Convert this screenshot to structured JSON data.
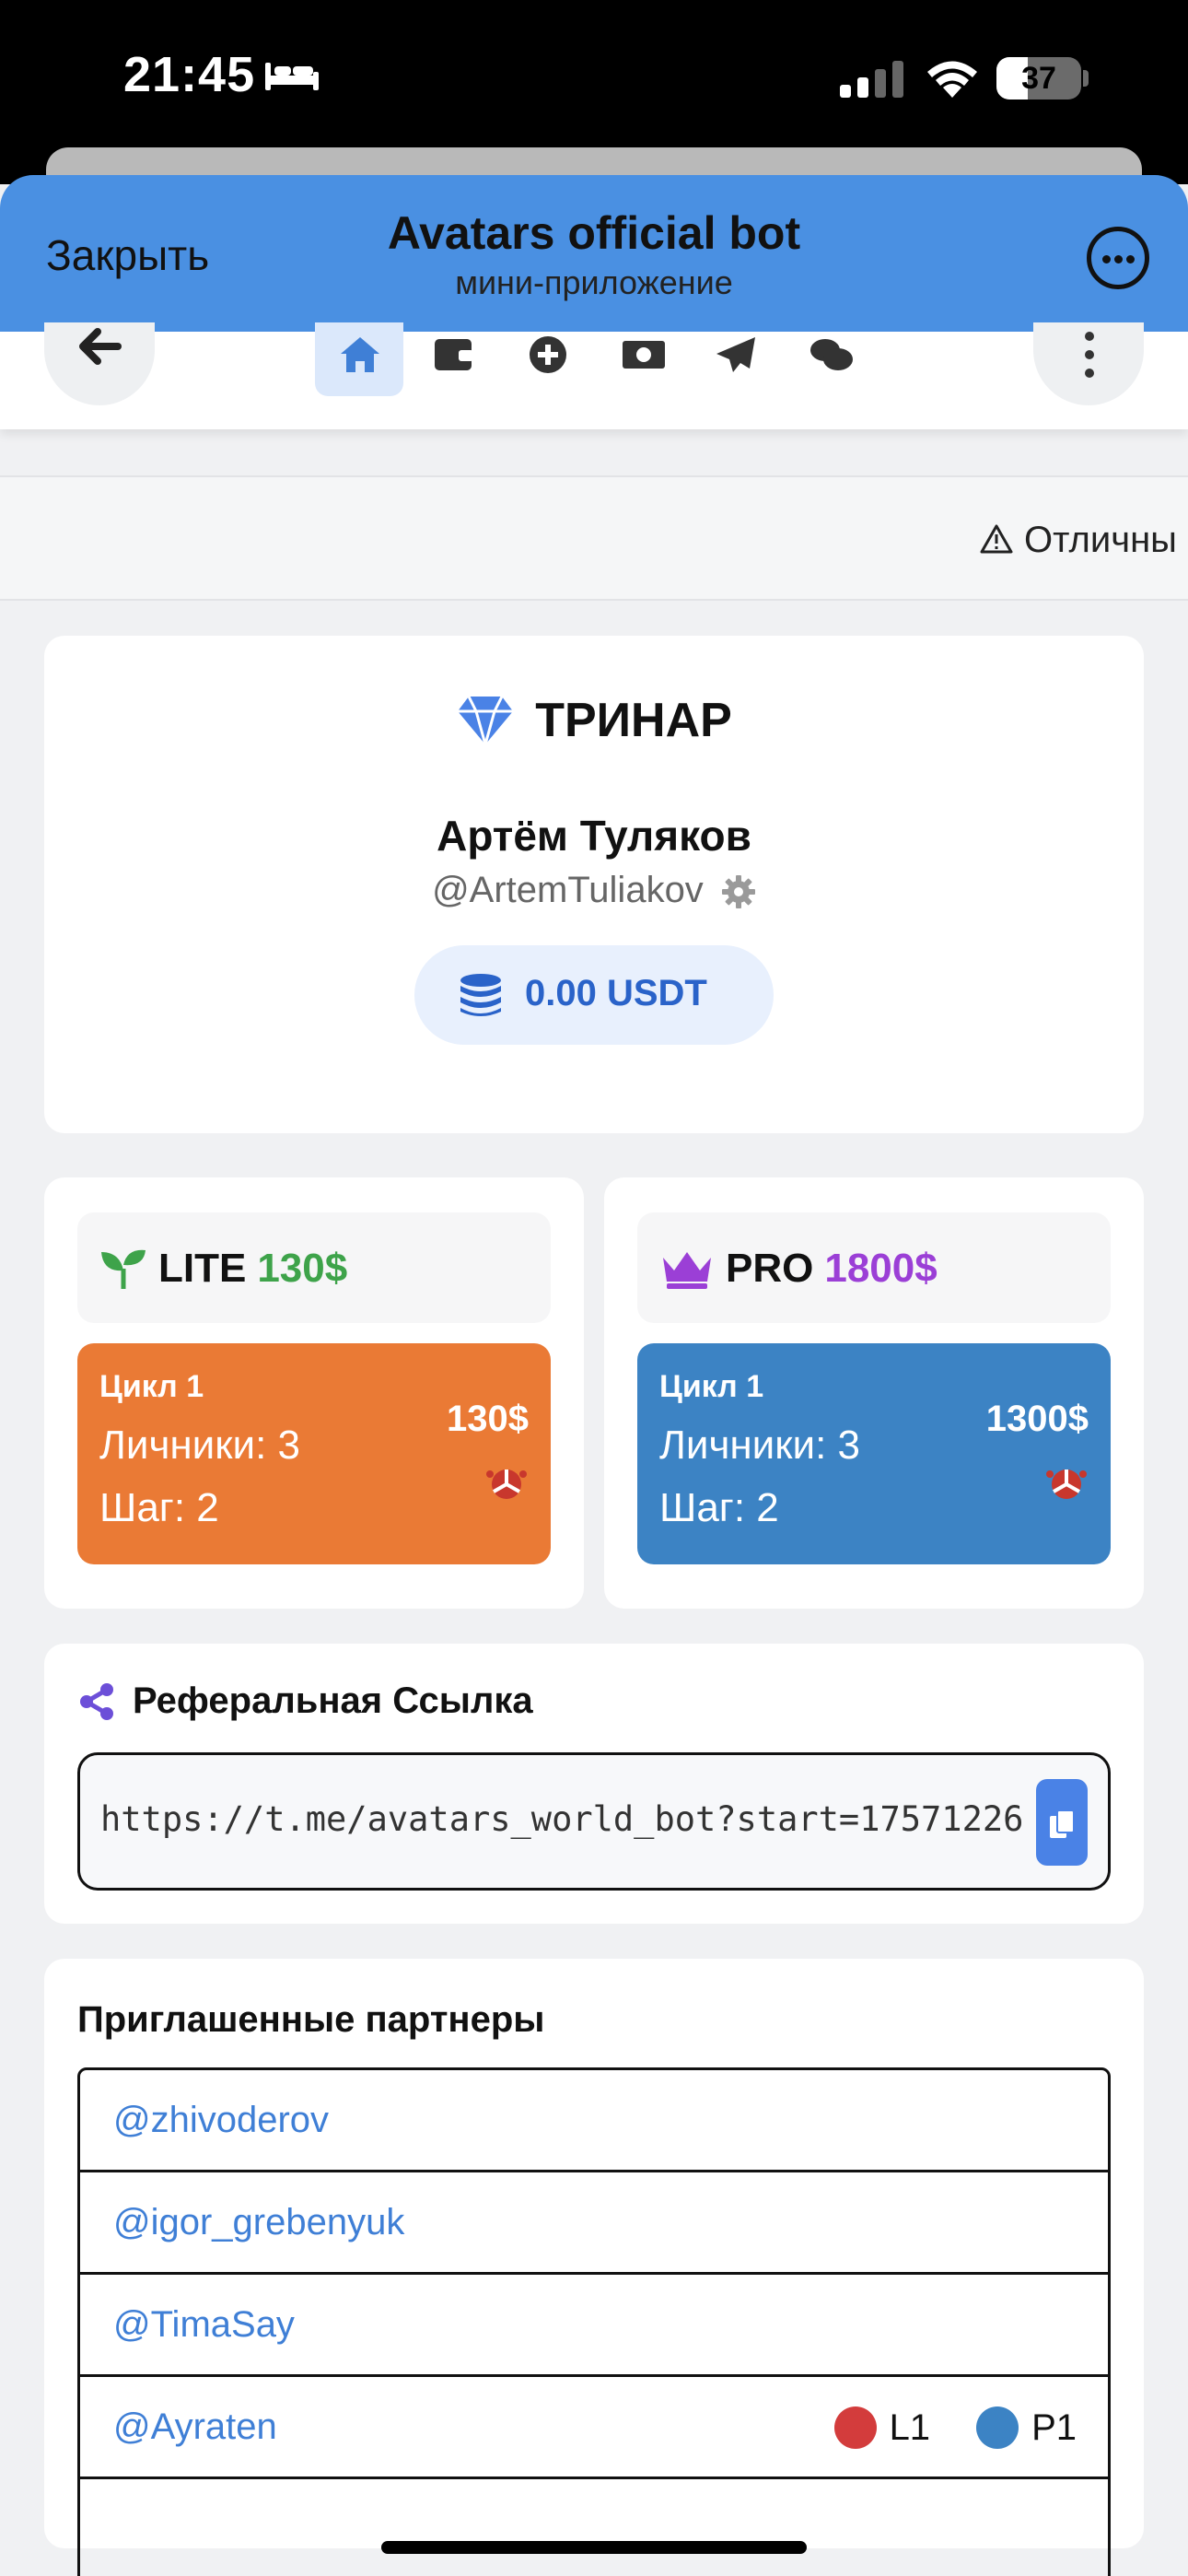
{
  "status_bar": {
    "time": "21:45",
    "battery": "37",
    "battery_fraction": 0.37
  },
  "telegram_header": {
    "close_label": "Закрыть",
    "title": "Avatars official bot",
    "subtitle": "мини-приложение"
  },
  "nav": {
    "icons": [
      "home-icon",
      "wallet-icon",
      "plus-circle-icon",
      "money-icon",
      "send-icon",
      "chat-icon"
    ],
    "active_index": 0
  },
  "notice": {
    "text": "Отличны"
  },
  "profile": {
    "brand": "ТРИНАР",
    "name": "Артём Туляков",
    "handle": "@ArtemTuliakov",
    "balance": "0.00 USDT"
  },
  "plans": {
    "lite": {
      "name": "LITE",
      "price": "130$",
      "cycle": "Цикл 1",
      "personal": "Личники: 3",
      "step": "Шаг: 2",
      "amount": "130$"
    },
    "pro": {
      "name": "PRO",
      "price": "1800$",
      "cycle": "Цикл 1",
      "personal": "Личники: 3",
      "step": "Шаг: 2",
      "amount": "1300$"
    }
  },
  "referral": {
    "title": "Реферальная Ссылка",
    "link": "https://t.me/avatars_world_bot?start=17571226"
  },
  "partners": {
    "title": "Приглашенные партнеры",
    "items": [
      {
        "handle": "@zhivoderov"
      },
      {
        "handle": "@igor_grebenyuk"
      },
      {
        "handle": "@TimaSay"
      },
      {
        "handle": "@Ayraten",
        "tags": [
          "L1",
          "P1"
        ]
      }
    ]
  },
  "colors": {
    "telegram_header": "#4a90e2",
    "lite_box": "#ea7a35",
    "pro_box": "#3c83c4",
    "lite_price": "#3ea34a",
    "pro_price": "#9b3fd6",
    "link": "#3f7fd6"
  }
}
